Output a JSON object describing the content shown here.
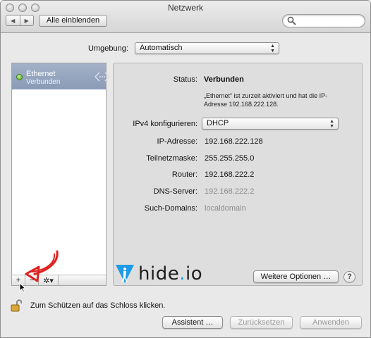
{
  "window": {
    "title": "Netzwerk"
  },
  "toolbar": {
    "back_glyph": "◀",
    "forward_glyph": "▶",
    "show_all_label": "Alle einblenden",
    "search_placeholder": ""
  },
  "location": {
    "label": "Umgebung:",
    "value": "Automatisch"
  },
  "services": [
    {
      "name": "Ethernet",
      "status": "Verbunden",
      "status_color": "#48a80f",
      "icon": "ethernet-connector-icon"
    }
  ],
  "list_controls": {
    "add": "+",
    "remove": "−",
    "gear": "✲▾"
  },
  "detail": {
    "status_label": "Status:",
    "status_value": "Verbunden",
    "status_description": "„Ethernet“ ist zurzeit aktiviert und hat die IP-Adresse 192.168.222.128.",
    "ipv4_label": "IPv4 konfigurieren:",
    "ipv4_value": "DHCP",
    "rows": [
      {
        "label": "IP-Adresse:",
        "value": "192.168.222.128",
        "dim": false
      },
      {
        "label": "Teilnetzmaske:",
        "value": "255.255.255.0",
        "dim": false
      },
      {
        "label": "Router:",
        "value": "192.168.222.2",
        "dim": false
      },
      {
        "label": "DNS-Server:",
        "value": "192.168.222.2",
        "dim": true
      },
      {
        "label": "Such-Domains:",
        "value": "localdomain",
        "dim": true
      }
    ],
    "more_options_label": "Weitere Optionen …",
    "help_label": "?"
  },
  "footer": {
    "lock_text": "Zum Schützen auf das Schloss klicken.",
    "assistant_label": "Assistent …",
    "revert_label": "Zurücksetzen",
    "apply_label": "Anwenden"
  },
  "watermark": {
    "brand": "hide",
    "dot": ".",
    "tld": "io",
    "accent": "#1d9be8"
  }
}
